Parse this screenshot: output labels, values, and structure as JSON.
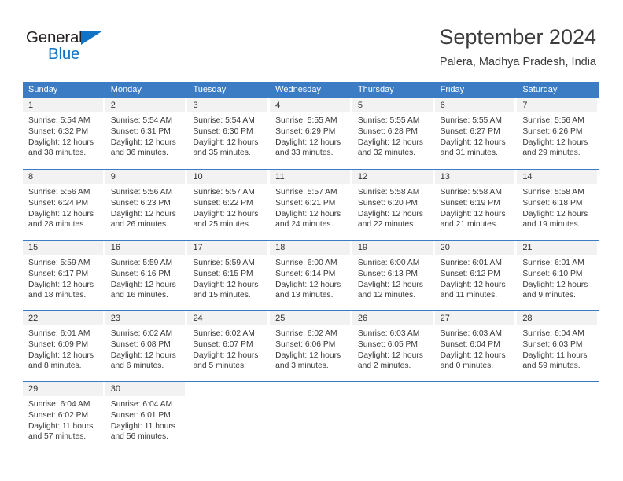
{
  "brand": {
    "name_part1": "General",
    "name_part2": "Blue",
    "accent_color": "#1273c4"
  },
  "header": {
    "title": "September 2024",
    "subtitle": "Palera, Madhya Pradesh, India"
  },
  "theme": {
    "header_blue": "#3b7cc4",
    "daynum_band": "#f2f2f2",
    "text": "#3a3a3a"
  },
  "weekdays": [
    "Sunday",
    "Monday",
    "Tuesday",
    "Wednesday",
    "Thursday",
    "Friday",
    "Saturday"
  ],
  "weeks": [
    [
      {
        "day": "1",
        "sunrise": "Sunrise: 5:54 AM",
        "sunset": "Sunset: 6:32 PM",
        "daylight1": "Daylight: 12 hours",
        "daylight2": "and 38 minutes."
      },
      {
        "day": "2",
        "sunrise": "Sunrise: 5:54 AM",
        "sunset": "Sunset: 6:31 PM",
        "daylight1": "Daylight: 12 hours",
        "daylight2": "and 36 minutes."
      },
      {
        "day": "3",
        "sunrise": "Sunrise: 5:54 AM",
        "sunset": "Sunset: 6:30 PM",
        "daylight1": "Daylight: 12 hours",
        "daylight2": "and 35 minutes."
      },
      {
        "day": "4",
        "sunrise": "Sunrise: 5:55 AM",
        "sunset": "Sunset: 6:29 PM",
        "daylight1": "Daylight: 12 hours",
        "daylight2": "and 33 minutes."
      },
      {
        "day": "5",
        "sunrise": "Sunrise: 5:55 AM",
        "sunset": "Sunset: 6:28 PM",
        "daylight1": "Daylight: 12 hours",
        "daylight2": "and 32 minutes."
      },
      {
        "day": "6",
        "sunrise": "Sunrise: 5:55 AM",
        "sunset": "Sunset: 6:27 PM",
        "daylight1": "Daylight: 12 hours",
        "daylight2": "and 31 minutes."
      },
      {
        "day": "7",
        "sunrise": "Sunrise: 5:56 AM",
        "sunset": "Sunset: 6:26 PM",
        "daylight1": "Daylight: 12 hours",
        "daylight2": "and 29 minutes."
      }
    ],
    [
      {
        "day": "8",
        "sunrise": "Sunrise: 5:56 AM",
        "sunset": "Sunset: 6:24 PM",
        "daylight1": "Daylight: 12 hours",
        "daylight2": "and 28 minutes."
      },
      {
        "day": "9",
        "sunrise": "Sunrise: 5:56 AM",
        "sunset": "Sunset: 6:23 PM",
        "daylight1": "Daylight: 12 hours",
        "daylight2": "and 26 minutes."
      },
      {
        "day": "10",
        "sunrise": "Sunrise: 5:57 AM",
        "sunset": "Sunset: 6:22 PM",
        "daylight1": "Daylight: 12 hours",
        "daylight2": "and 25 minutes."
      },
      {
        "day": "11",
        "sunrise": "Sunrise: 5:57 AM",
        "sunset": "Sunset: 6:21 PM",
        "daylight1": "Daylight: 12 hours",
        "daylight2": "and 24 minutes."
      },
      {
        "day": "12",
        "sunrise": "Sunrise: 5:58 AM",
        "sunset": "Sunset: 6:20 PM",
        "daylight1": "Daylight: 12 hours",
        "daylight2": "and 22 minutes."
      },
      {
        "day": "13",
        "sunrise": "Sunrise: 5:58 AM",
        "sunset": "Sunset: 6:19 PM",
        "daylight1": "Daylight: 12 hours",
        "daylight2": "and 21 minutes."
      },
      {
        "day": "14",
        "sunrise": "Sunrise: 5:58 AM",
        "sunset": "Sunset: 6:18 PM",
        "daylight1": "Daylight: 12 hours",
        "daylight2": "and 19 minutes."
      }
    ],
    [
      {
        "day": "15",
        "sunrise": "Sunrise: 5:59 AM",
        "sunset": "Sunset: 6:17 PM",
        "daylight1": "Daylight: 12 hours",
        "daylight2": "and 18 minutes."
      },
      {
        "day": "16",
        "sunrise": "Sunrise: 5:59 AM",
        "sunset": "Sunset: 6:16 PM",
        "daylight1": "Daylight: 12 hours",
        "daylight2": "and 16 minutes."
      },
      {
        "day": "17",
        "sunrise": "Sunrise: 5:59 AM",
        "sunset": "Sunset: 6:15 PM",
        "daylight1": "Daylight: 12 hours",
        "daylight2": "and 15 minutes."
      },
      {
        "day": "18",
        "sunrise": "Sunrise: 6:00 AM",
        "sunset": "Sunset: 6:14 PM",
        "daylight1": "Daylight: 12 hours",
        "daylight2": "and 13 minutes."
      },
      {
        "day": "19",
        "sunrise": "Sunrise: 6:00 AM",
        "sunset": "Sunset: 6:13 PM",
        "daylight1": "Daylight: 12 hours",
        "daylight2": "and 12 minutes."
      },
      {
        "day": "20",
        "sunrise": "Sunrise: 6:01 AM",
        "sunset": "Sunset: 6:12 PM",
        "daylight1": "Daylight: 12 hours",
        "daylight2": "and 11 minutes."
      },
      {
        "day": "21",
        "sunrise": "Sunrise: 6:01 AM",
        "sunset": "Sunset: 6:10 PM",
        "daylight1": "Daylight: 12 hours",
        "daylight2": "and 9 minutes."
      }
    ],
    [
      {
        "day": "22",
        "sunrise": "Sunrise: 6:01 AM",
        "sunset": "Sunset: 6:09 PM",
        "daylight1": "Daylight: 12 hours",
        "daylight2": "and 8 minutes."
      },
      {
        "day": "23",
        "sunrise": "Sunrise: 6:02 AM",
        "sunset": "Sunset: 6:08 PM",
        "daylight1": "Daylight: 12 hours",
        "daylight2": "and 6 minutes."
      },
      {
        "day": "24",
        "sunrise": "Sunrise: 6:02 AM",
        "sunset": "Sunset: 6:07 PM",
        "daylight1": "Daylight: 12 hours",
        "daylight2": "and 5 minutes."
      },
      {
        "day": "25",
        "sunrise": "Sunrise: 6:02 AM",
        "sunset": "Sunset: 6:06 PM",
        "daylight1": "Daylight: 12 hours",
        "daylight2": "and 3 minutes."
      },
      {
        "day": "26",
        "sunrise": "Sunrise: 6:03 AM",
        "sunset": "Sunset: 6:05 PM",
        "daylight1": "Daylight: 12 hours",
        "daylight2": "and 2 minutes."
      },
      {
        "day": "27",
        "sunrise": "Sunrise: 6:03 AM",
        "sunset": "Sunset: 6:04 PM",
        "daylight1": "Daylight: 12 hours",
        "daylight2": "and 0 minutes."
      },
      {
        "day": "28",
        "sunrise": "Sunrise: 6:04 AM",
        "sunset": "Sunset: 6:03 PM",
        "daylight1": "Daylight: 11 hours",
        "daylight2": "and 59 minutes."
      }
    ],
    [
      {
        "day": "29",
        "sunrise": "Sunrise: 6:04 AM",
        "sunset": "Sunset: 6:02 PM",
        "daylight1": "Daylight: 11 hours",
        "daylight2": "and 57 minutes."
      },
      {
        "day": "30",
        "sunrise": "Sunrise: 6:04 AM",
        "sunset": "Sunset: 6:01 PM",
        "daylight1": "Daylight: 11 hours",
        "daylight2": "and 56 minutes."
      },
      {
        "day": "",
        "sunrise": "",
        "sunset": "",
        "daylight1": "",
        "daylight2": ""
      },
      {
        "day": "",
        "sunrise": "",
        "sunset": "",
        "daylight1": "",
        "daylight2": ""
      },
      {
        "day": "",
        "sunrise": "",
        "sunset": "",
        "daylight1": "",
        "daylight2": ""
      },
      {
        "day": "",
        "sunrise": "",
        "sunset": "",
        "daylight1": "",
        "daylight2": ""
      },
      {
        "day": "",
        "sunrise": "",
        "sunset": "",
        "daylight1": "",
        "daylight2": ""
      }
    ]
  ]
}
